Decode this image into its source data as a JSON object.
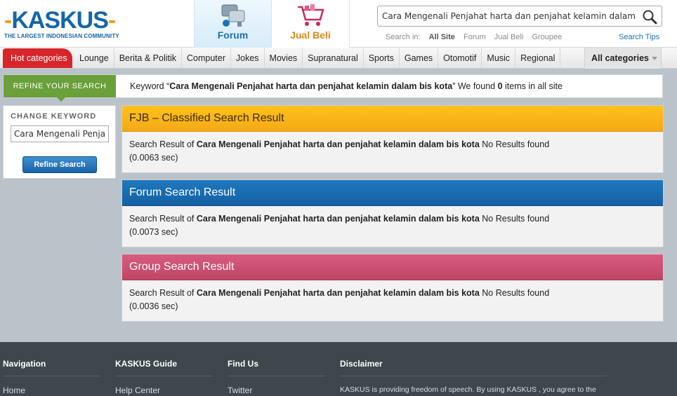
{
  "header": {
    "logo_text": "KASKUS",
    "logo_tagline": "THE LARGEST INDONESIAN COMMUNITY",
    "tabs": [
      {
        "label": "Forum",
        "active": true
      },
      {
        "label": "Jual Beli",
        "active": false
      }
    ],
    "search": {
      "value": "Cara Mengenali Penjahat harta dan penjahat kelamin dalam bis kota",
      "search_in_label": "Search in:",
      "scopes": [
        "All Site",
        "Forum",
        "Jual Beli",
        "Groupee"
      ],
      "selected_scope": "All Site",
      "tips_label": "Search Tips"
    }
  },
  "nav": {
    "hot_label": "Hot categories",
    "items": [
      "Lounge",
      "Berita & Politik",
      "Computer",
      "Jokes",
      "Movies",
      "Supranatural",
      "Sports",
      "Games",
      "Otomotif",
      "Music",
      "Regional"
    ],
    "all_label": "All categories"
  },
  "refine": {
    "label": "REFINE YOUR SEARCH",
    "keyword_prefix": "Keyword “",
    "keyword": "Cara Mengenali Penjahat harta dan penjahat kelamin dalam bis kota",
    "keyword_suffix": "” We found ",
    "count": "0",
    "count_suffix": " items in all site"
  },
  "sidebar": {
    "title": "CHANGE KEYWORD",
    "input_value": "Cara Mengenali Penjahat harta dan penjahat kelamin dalam bis kota",
    "button_label": "Refine Search"
  },
  "results": [
    {
      "title": "FJB – Classified Search Result",
      "prefix": "Search Result of ",
      "keyword": "Cara Mengenali Penjahat harta dan penjahat kelamin dalam bis kota",
      "suffix": "  No Results found (0.0063 sec)"
    },
    {
      "title": "Forum Search Result",
      "prefix": "Search Result of ",
      "keyword": "Cara Mengenali Penjahat harta dan penjahat kelamin dalam bis kota",
      "suffix": " No Results found (0.0073 sec)"
    },
    {
      "title": "Group Search Result",
      "prefix": "Search Result of ",
      "keyword": "Cara Mengenali Penjahat harta dan penjahat kelamin dalam bis kota",
      "suffix": " No Results found (0.0036 sec)"
    }
  ],
  "footer": {
    "columns": [
      {
        "title": "Navigation",
        "first": "Home"
      },
      {
        "title": "KASKUS Guide",
        "first": "Help Center"
      },
      {
        "title": "Find Us",
        "first": "Twitter"
      },
      {
        "title": "Disclaimer",
        "first": "KASKUS is providing freedom of speech. By using KASKUS , you agree to the"
      }
    ]
  },
  "colors": {
    "brand_blue": "#1565a8",
    "hot_red": "#d6262c",
    "refine_green": "#6a9f3a",
    "fjb_yellow": "#f4a915",
    "forum_blue": "#1460a3",
    "group_pink": "#c04566"
  }
}
